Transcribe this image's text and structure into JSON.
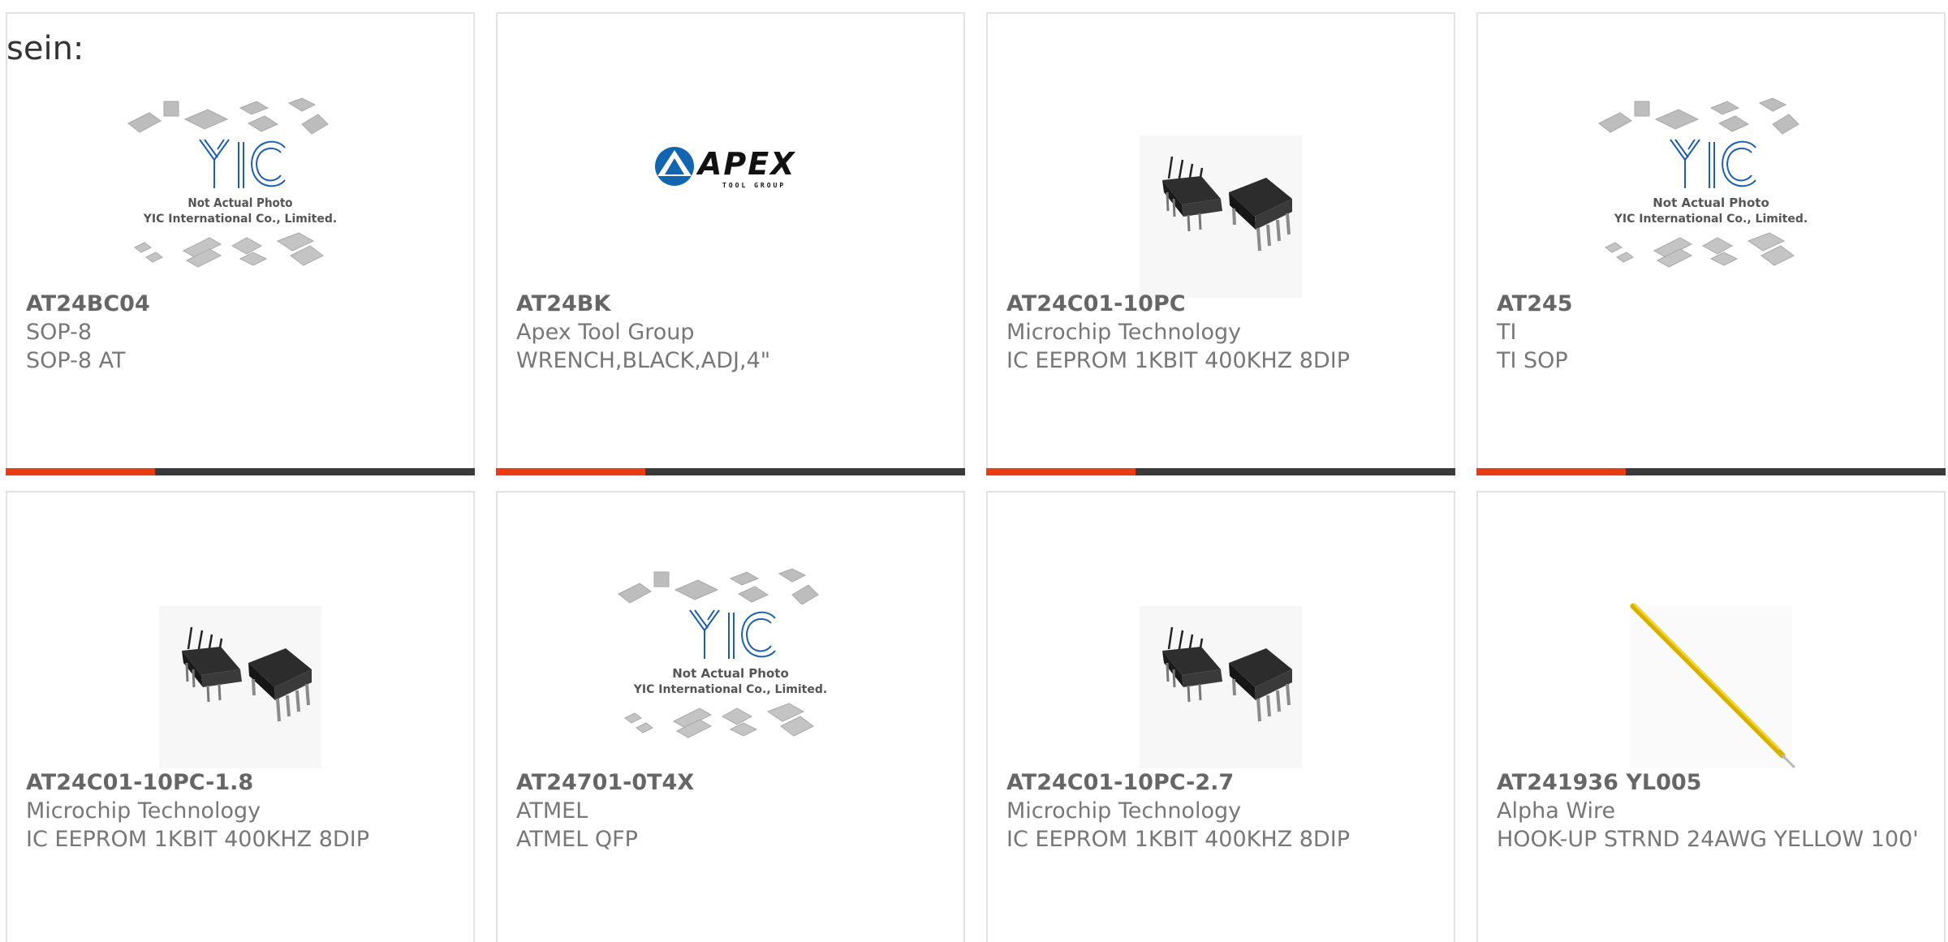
{
  "lead_text": "sein:",
  "colors": {
    "accent": "#ea3c12",
    "bar": "#3a3a3a",
    "border": "#e2e2e2",
    "title": "#666666",
    "text": "#777777",
    "yic_blue": "#1c5fb0"
  },
  "placeholder_caption": {
    "line1": "Not Actual Photo",
    "line2": "YIC International Co., Limited."
  },
  "apex_logo": {
    "word": "APEX",
    "tagline": "TOOL GROUP"
  },
  "products": [
    {
      "part": "AT24BC04",
      "maker": "SOP-8",
      "desc": "SOP-8 AT",
      "image": "yic-placeholder-image"
    },
    {
      "part": "AT24BK",
      "maker": "Apex Tool Group",
      "desc": "WRENCH,BLACK,ADJ,4\"",
      "image": "apex-logo"
    },
    {
      "part": "AT24C01-10PC",
      "maker": "Microchip Technology",
      "desc": "IC EEPROM 1KBIT 400KHZ 8DIP",
      "image": "dip-chip-image"
    },
    {
      "part": "AT245",
      "maker": "TI",
      "desc": "TI SOP",
      "image": "yic-placeholder-image"
    },
    {
      "part": "AT24C01-10PC-1.8",
      "maker": "Microchip Technology",
      "desc": "IC EEPROM 1KBIT 400KHZ 8DIP",
      "image": "dip-chip-image"
    },
    {
      "part": "AT24701-0T4X",
      "maker": "ATMEL",
      "desc": "ATMEL QFP",
      "image": "yic-placeholder-image"
    },
    {
      "part": "AT24C01-10PC-2.7",
      "maker": "Microchip Technology",
      "desc": "IC EEPROM 1KBIT 400KHZ 8DIP",
      "image": "dip-chip-image"
    },
    {
      "part": "AT241936 YL005",
      "maker": "Alpha Wire",
      "desc": "HOOK-UP STRND 24AWG YELLOW 100'",
      "image": "yellow-wire-image"
    }
  ]
}
